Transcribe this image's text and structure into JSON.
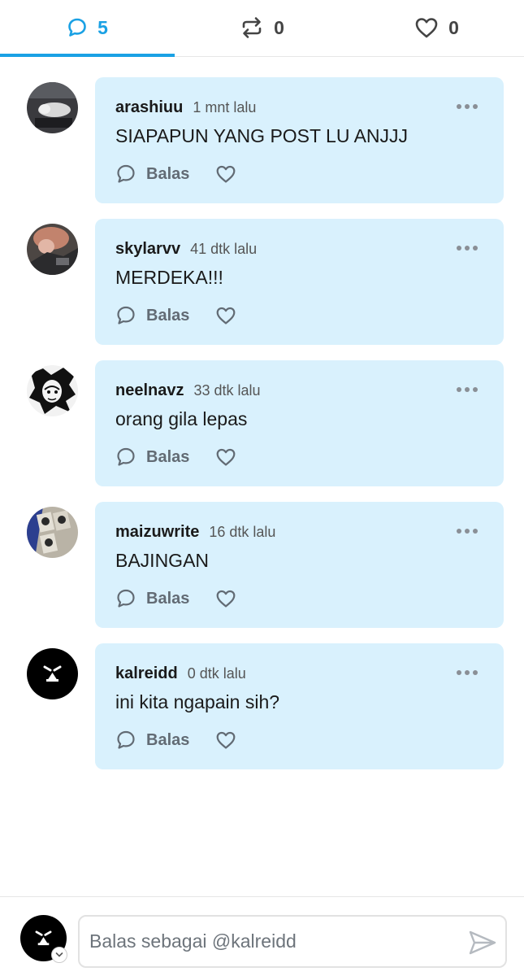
{
  "tabs": [
    {
      "name": "comments",
      "icon": "comment-icon",
      "count": "5",
      "active": true
    },
    {
      "name": "reblogs",
      "icon": "repost-icon",
      "count": "0",
      "active": false
    },
    {
      "name": "likes",
      "icon": "heart-icon",
      "count": "0",
      "active": false
    }
  ],
  "colors": {
    "accent": "#1aa1e4",
    "bubble": "#d9f1fd",
    "muted": "#626b74"
  },
  "comments": [
    {
      "username": "arashiuu",
      "time": "1 mnt lalu",
      "text": "SIAPAPUN YANG POST LU ANJJJ",
      "reply_label": "Balas"
    },
    {
      "username": "skylarvv",
      "time": "41 dtk lalu",
      "text": "MERDEKA!!!",
      "reply_label": "Balas"
    },
    {
      "username": "neelnavz",
      "time": "33 dtk lalu",
      "text": "orang gila lepas",
      "reply_label": "Balas"
    },
    {
      "username": "maizuwrite",
      "time": "16 dtk lalu",
      "text": "BAJINGAN",
      "reply_label": "Balas"
    },
    {
      "username": "kalreidd",
      "time": "0 dtk lalu",
      "text": "ini kita ngapain sih?",
      "reply_label": "Balas"
    }
  ],
  "footer": {
    "placeholder": "Balas sebagai @kalreidd"
  }
}
